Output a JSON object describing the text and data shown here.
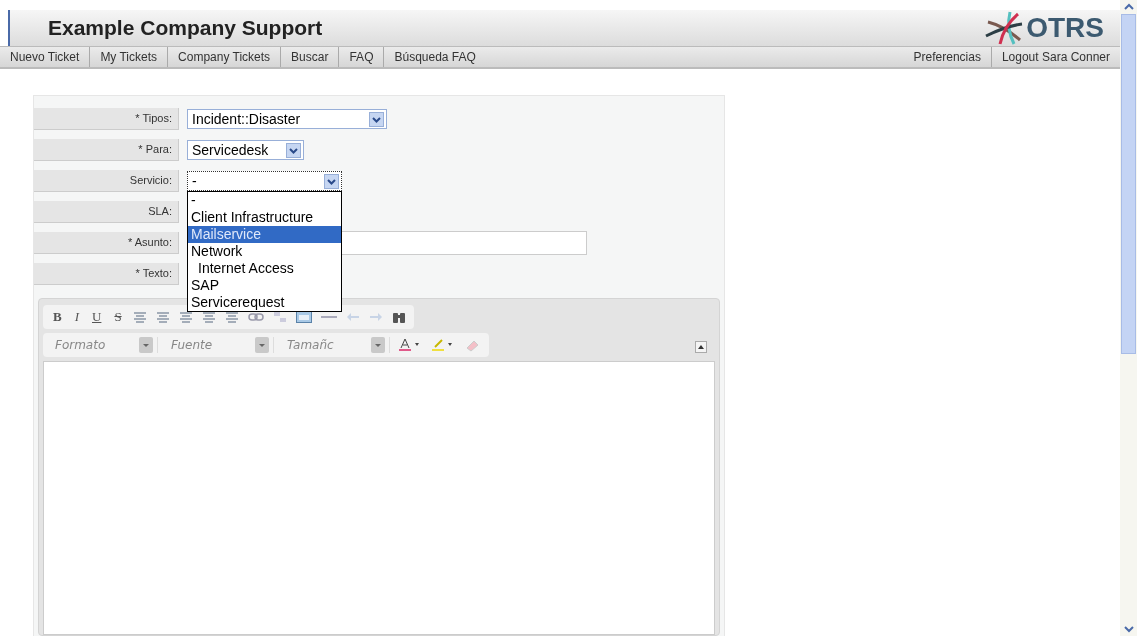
{
  "header": {
    "title": "Example Company Support",
    "logo": "OTRS"
  },
  "nav": {
    "left": [
      {
        "label": "Nuevo Ticket"
      },
      {
        "label": "My Tickets"
      },
      {
        "label": "Company Tickets"
      },
      {
        "label": "Buscar"
      },
      {
        "label": "FAQ"
      },
      {
        "label": "Búsqueda FAQ"
      }
    ],
    "right": [
      {
        "label": "Preferencias"
      },
      {
        "label": "Logout Sara Conner"
      }
    ]
  },
  "form": {
    "fields": [
      {
        "label": "* Tipos:",
        "kind": "select",
        "value": "Incident::Disaster",
        "focused": false
      },
      {
        "label": "* Para:",
        "kind": "select",
        "value": "Servicedesk",
        "focused": false
      },
      {
        "label": "Servicio:",
        "kind": "select",
        "value": "-",
        "focused": true
      },
      {
        "label": "SLA:",
        "kind": "none"
      },
      {
        "label": "* Asunto:",
        "kind": "input"
      },
      {
        "label": "* Texto:",
        "kind": "none"
      }
    ]
  },
  "service_dropdown": {
    "options": [
      {
        "label": "-",
        "selected": false
      },
      {
        "label": "Client Infrastructure",
        "selected": false
      },
      {
        "label": "Mailservice",
        "selected": true
      },
      {
        "label": "Network",
        "selected": false,
        "children": [
          {
            "label": "Internet Access",
            "selected": false
          }
        ]
      },
      {
        "label": "SAP",
        "selected": false
      },
      {
        "label": "Servicerequest",
        "selected": false
      }
    ]
  },
  "editor": {
    "text_buttons": [
      {
        "label": "B"
      },
      {
        "label": "I"
      },
      {
        "label": "U"
      },
      {
        "label": "S"
      }
    ],
    "combos": [
      {
        "placeholder": "Formato"
      },
      {
        "placeholder": "Fuente"
      },
      {
        "placeholder": "Tamañc"
      }
    ]
  }
}
